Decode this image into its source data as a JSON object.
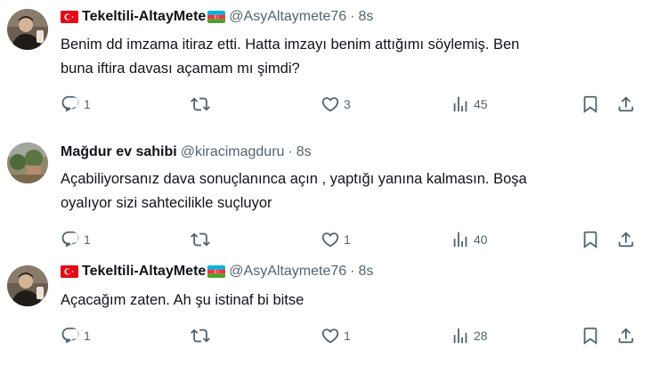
{
  "tweets": [
    {
      "author": "Tekeltili-AltayMete",
      "handle": "@AsyAltaymete76",
      "time": "8s",
      "text": "Benim dd imzama itiraz etti. Hatta imzayı benim attığımı söylemiş. Ben\nbuna iftira davası açamam mı şimdi?",
      "replies": "1",
      "retweets": "",
      "likes": "3",
      "views": "45",
      "flags": [
        "turkey-flag",
        "azerbaijan-flag"
      ]
    },
    {
      "author": "Mağdur ev sahibi",
      "handle": "@kiracimagduru",
      "time": "8s",
      "text": "Açabiliyorsanız dava sonuçlanınca açın , yaptığı yanına kalmasın. Boşa\noyalıyor sizi sahtecilikle suçluyor",
      "replies": "1",
      "retweets": "",
      "likes": "1",
      "views": "40"
    },
    {
      "author": "Tekeltili-AltayMete",
      "handle": "@AsyAltaymete76",
      "time": "8s",
      "text": "Açacağım zaten. Ah şu istinaf bi bitse",
      "replies": "1",
      "retweets": "",
      "likes": "1",
      "views": "28",
      "flags": [
        "turkey-flag",
        "azerbaijan-flag"
      ]
    }
  ],
  "separator": "·",
  "colors": {
    "text": "#0f1419",
    "muted": "#536471",
    "turkey_red": "#e30a17",
    "az_blue": "#00b5e2",
    "az_red": "#ef3340",
    "az_green": "#509e2f"
  }
}
